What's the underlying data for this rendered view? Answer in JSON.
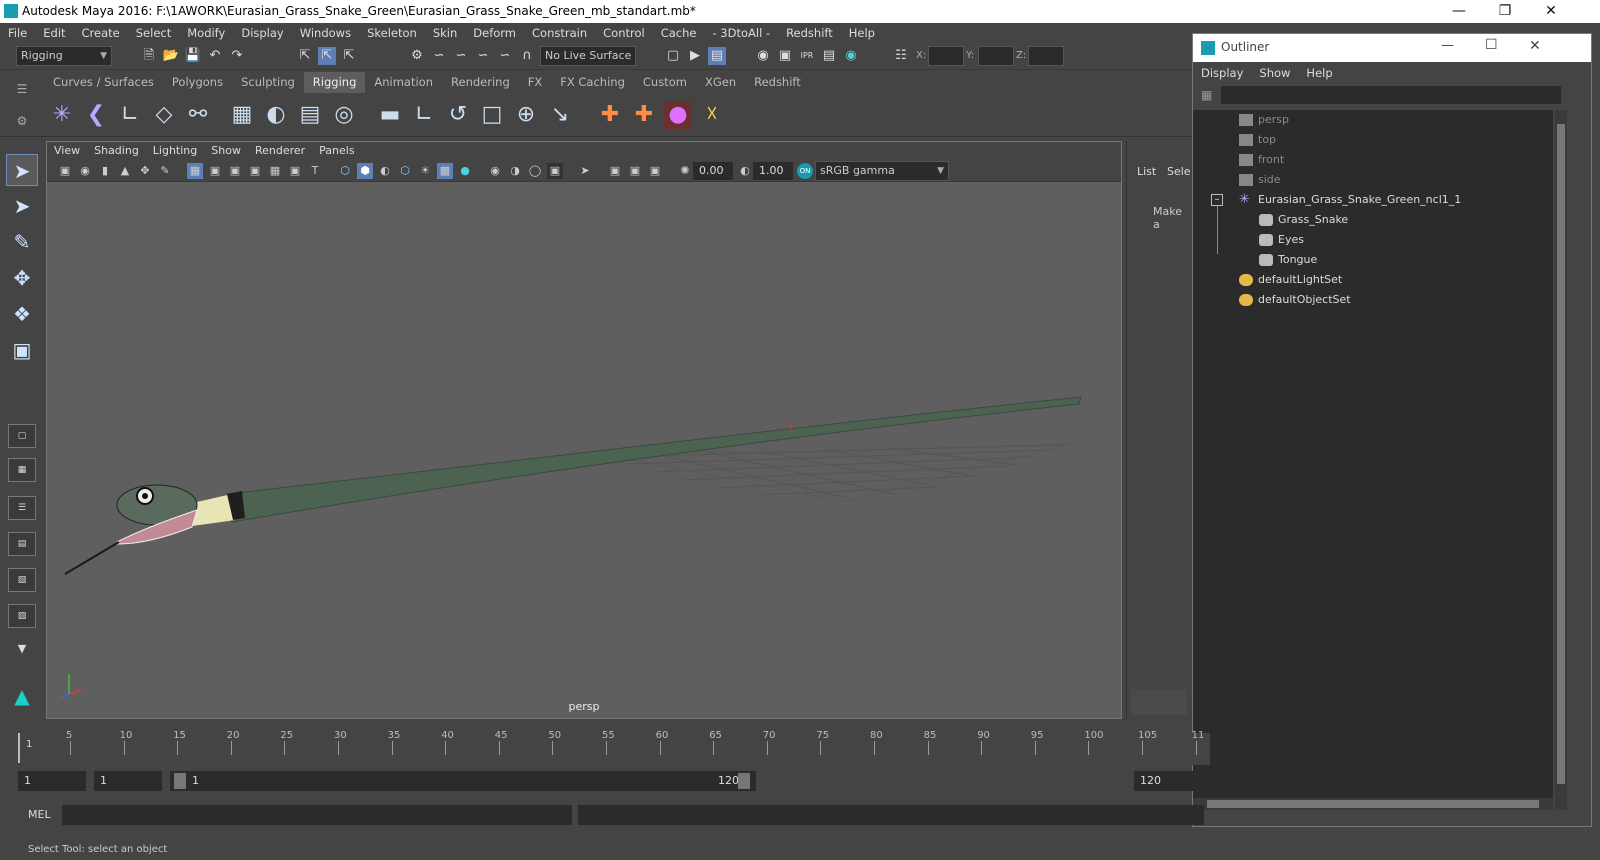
{
  "window": {
    "title": "Autodesk Maya 2016: F:\\1AWORK\\Eurasian_Grass_Snake_Green\\Eurasian_Grass_Snake_Green_mb_standart.mb*"
  },
  "menubar": [
    "File",
    "Edit",
    "Create",
    "Select",
    "Modify",
    "Display",
    "Windows",
    "Skeleton",
    "Skin",
    "Deform",
    "Constrain",
    "Control",
    "Cache",
    "- 3DtoAll -",
    "Redshift",
    "Help"
  ],
  "statusline": {
    "mode": "Rigging",
    "live_surface": "No Live Surface",
    "x_label": "X:",
    "y_label": "Y:",
    "z_label": "Z:"
  },
  "shelf_tabs": [
    {
      "label": "Curves / Surfaces",
      "active": false
    },
    {
      "label": "Polygons",
      "active": false
    },
    {
      "label": "Sculpting",
      "active": false
    },
    {
      "label": "Rigging",
      "active": true
    },
    {
      "label": "Animation",
      "active": false
    },
    {
      "label": "Rendering",
      "active": false
    },
    {
      "label": "FX",
      "active": false
    },
    {
      "label": "FX Caching",
      "active": false
    },
    {
      "label": "Custom",
      "active": false
    },
    {
      "label": "XGen",
      "active": false
    },
    {
      "label": "Redshift",
      "active": false
    }
  ],
  "viewport": {
    "menu": [
      "View",
      "Shading",
      "Lighting",
      "Show",
      "Renderer",
      "Panels"
    ],
    "exposure": "0.00",
    "gamma": "1.00",
    "color_space": "sRGB gamma",
    "camera": "persp"
  },
  "channelbox": {
    "tabs": [
      "List",
      "Sele"
    ],
    "hint": "Make a"
  },
  "outliner": {
    "title": "Outliner",
    "menu": [
      "Display",
      "Show",
      "Help"
    ],
    "items": [
      {
        "label": "persp",
        "level": 0,
        "dim": true,
        "icon": "camera-icon"
      },
      {
        "label": "top",
        "level": 0,
        "dim": true,
        "icon": "camera-icon"
      },
      {
        "label": "front",
        "level": 0,
        "dim": true,
        "icon": "camera-icon"
      },
      {
        "label": "side",
        "level": 0,
        "dim": true,
        "icon": "camera-icon"
      },
      {
        "label": "Eurasian_Grass_Snake_Green_ncl1_1",
        "level": 0,
        "dim": false,
        "icon": "joint-icon"
      },
      {
        "label": "Grass_Snake",
        "level": 1,
        "dim": false,
        "icon": "mesh-icon"
      },
      {
        "label": "Eyes",
        "level": 1,
        "dim": false,
        "icon": "mesh-icon"
      },
      {
        "label": "Tongue",
        "level": 1,
        "dim": false,
        "icon": "mesh-icon"
      },
      {
        "label": "defaultLightSet",
        "level": 0,
        "dim": false,
        "icon": "set-icon"
      },
      {
        "label": "defaultObjectSet",
        "level": 0,
        "dim": false,
        "icon": "set-icon"
      }
    ]
  },
  "timeline": {
    "current_frame_marker": "1",
    "ticks": [
      "5",
      "10",
      "15",
      "20",
      "25",
      "30",
      "35",
      "40",
      "45",
      "50",
      "55",
      "60",
      "65",
      "70",
      "75",
      "80",
      "85",
      "90",
      "95",
      "100",
      "105",
      "11"
    ]
  },
  "range": {
    "start": "1",
    "playback_start": "1",
    "slider_start": "1",
    "slider_end": "120",
    "end": "120"
  },
  "commandline": {
    "language": "MEL"
  },
  "helpline": "Select Tool: select an object",
  "colors": {
    "accent": "#5d7fb5",
    "snake_body": "#4c6352"
  }
}
